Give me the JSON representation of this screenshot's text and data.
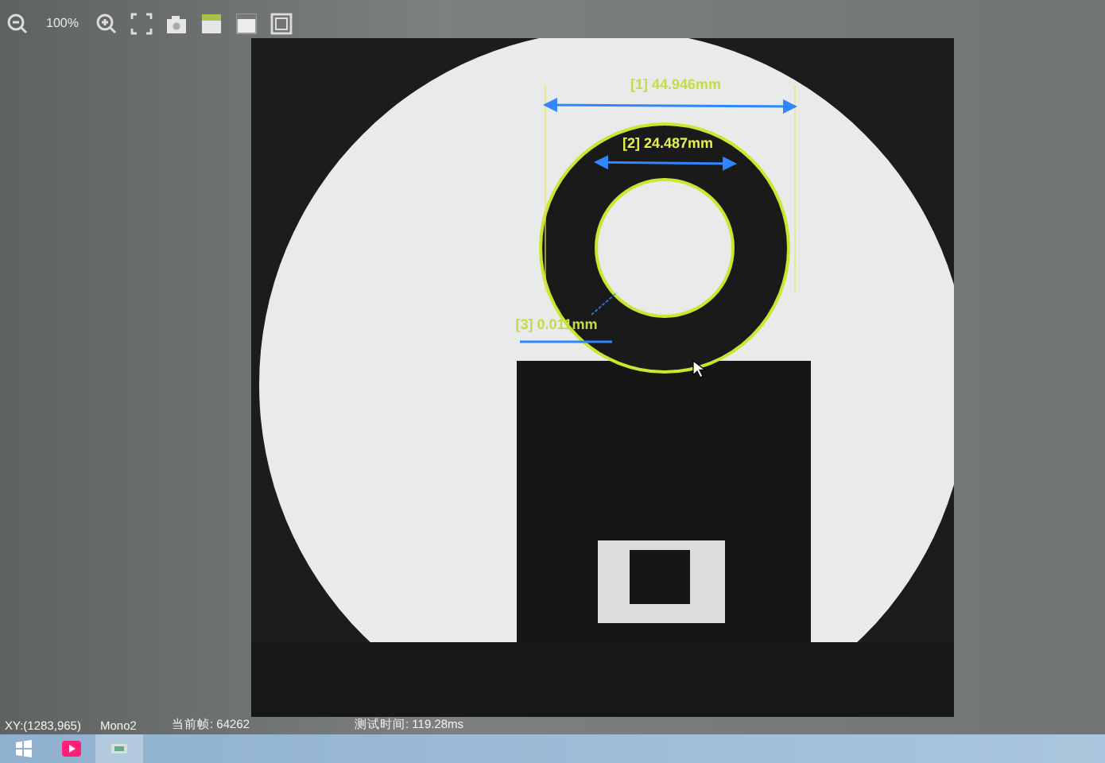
{
  "toolbar": {
    "zoom": "100%"
  },
  "measurements": [
    {
      "label": "[1] 44.946mm"
    },
    {
      "label": "[2] 24.487mm"
    },
    {
      "label": "[3] 0.011mm"
    }
  ],
  "status_bar": {
    "coordinates": "XY:(1283,965)",
    "pixel_format": "Mono2",
    "frame": "当前帧: 64262",
    "test_time": "测试时间: 119.28ms"
  }
}
